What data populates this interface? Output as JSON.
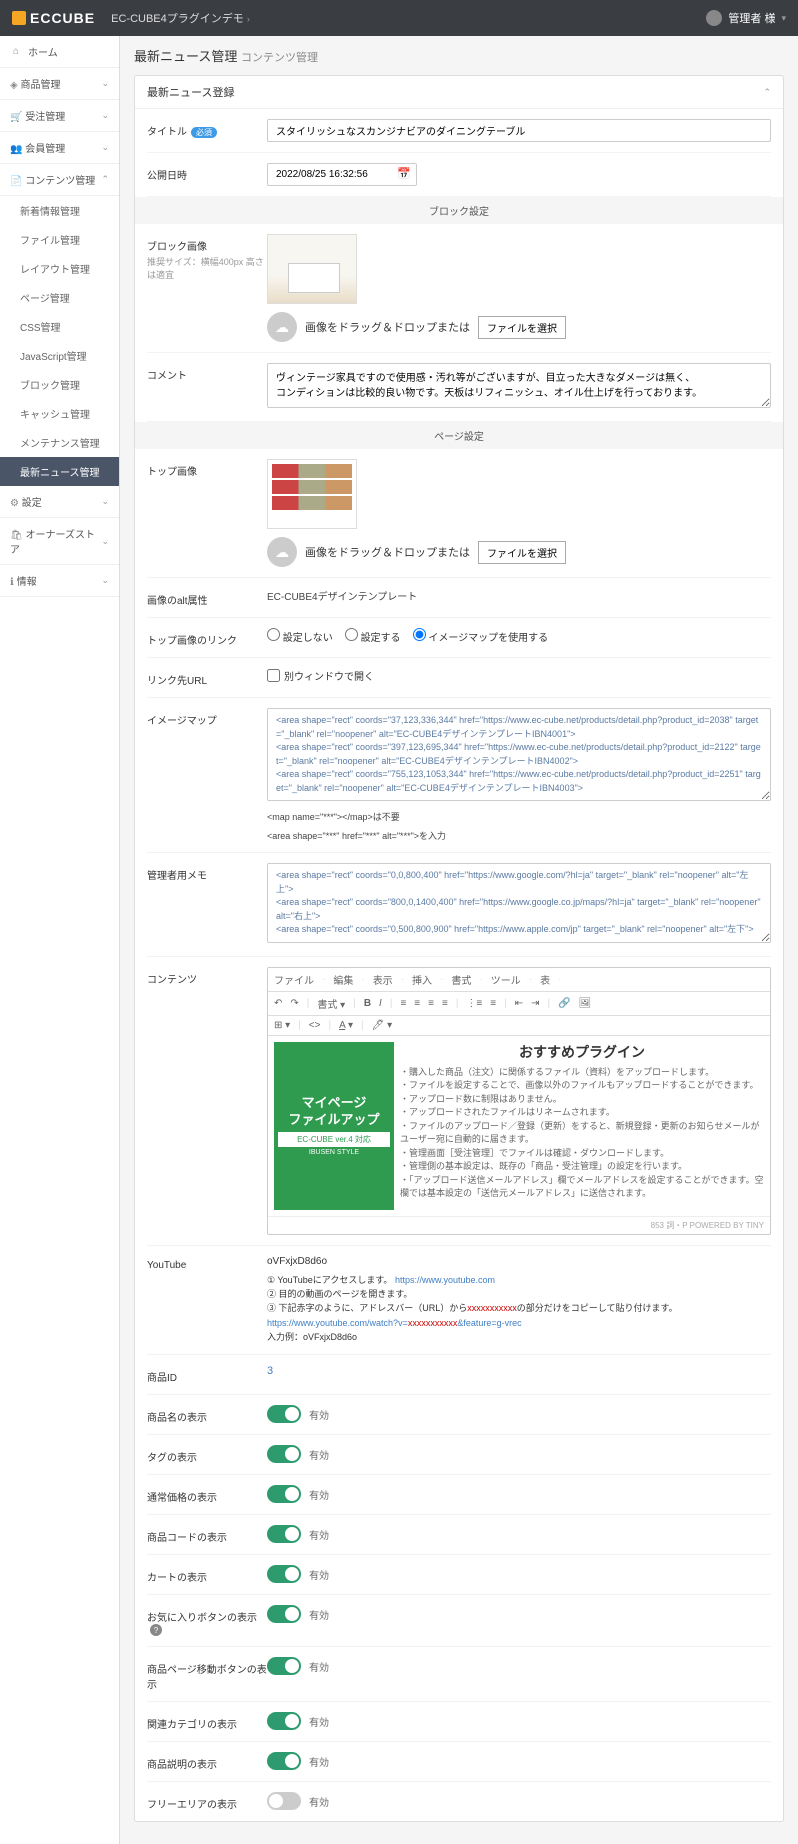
{
  "topbar": {
    "logo": "ECCUBE",
    "site": "EC-CUBE4プラグインデモ",
    "user": "管理者 様"
  },
  "sidebar": {
    "items": [
      {
        "label": "ホーム",
        "icon": "⌂"
      },
      {
        "label": "商品管理",
        "icon": "◈",
        "expandable": true
      },
      {
        "label": "受注管理",
        "icon": "🛒",
        "expandable": true
      },
      {
        "label": "会員管理",
        "icon": "👥",
        "expandable": true
      },
      {
        "label": "コンテンツ管理",
        "icon": "📄",
        "expandable": true
      }
    ],
    "content_sub": [
      "新着情報管理",
      "ファイル管理",
      "レイアウト管理",
      "ページ管理",
      "CSS管理",
      "JavaScript管理",
      "ブロック管理",
      "キャッシュ管理",
      "メンテナンス管理",
      "最新ニュース管理"
    ],
    "bottom": [
      {
        "label": "設定",
        "icon": "⚙"
      },
      {
        "label": "オーナーズストア",
        "icon": "🛍"
      },
      {
        "label": "情報",
        "icon": "ℹ"
      }
    ]
  },
  "page": {
    "title": "最新ニュース管理",
    "sub": "コンテンツ管理"
  },
  "panel_title": "最新ニュース登録",
  "labels": {
    "title": "タイトル",
    "required": "必須",
    "date": "公開日時",
    "block_section": "ブロック設定",
    "block_image": "ブロック画像",
    "block_image_note": "推奨サイズ：横幅400px 高さは適宜",
    "upload_hint": "画像をドラッグ＆ドロップまたは",
    "file_select": "ファイルを選択",
    "comment": "コメント",
    "page_section": "ページ設定",
    "top_image": "トップ画像",
    "image_alt": "画像のalt属性",
    "top_link": "トップ画像のリンク",
    "link_url": "リンク先URL",
    "imagemap": "イメージマップ",
    "admin_memo": "管理者用メモ",
    "contents": "コンテンツ",
    "youtube": "YouTube",
    "product_id": "商品ID",
    "show_product_name": "商品名の表示",
    "show_tag": "タグの表示",
    "show_price": "通常価格の表示",
    "show_product_code": "商品コードの表示",
    "show_cart": "カートの表示",
    "show_fav": "お気に入りボタンの表示",
    "show_detail_btn": "商品ページ移動ボタンの表示",
    "show_category": "関連カテゴリの表示",
    "show_desc": "商品説明の表示",
    "show_free": "フリーエリアの表示"
  },
  "values": {
    "title": "スタイリッシュなスカンジナビアのダイニングテーブル",
    "date": "2022/08/25 16:32:56",
    "comment": "ヴィンテージ家具ですので使用感・汚れ等がございますが、目立った大きなダメージは無く、\nコンディションは比較的良い物です。天板はリフィニッシュ、オイル仕上げを行っております。",
    "image_alt": "EC-CUBE4デザインテンプレート",
    "link_radio": [
      "設定しない",
      "設定する",
      "イメージマップを使用する"
    ],
    "link_radio_selected": 2,
    "new_window": "別ウィンドウで開く",
    "imagemap": "<area shape=\"rect\" coords=\"37,123,336,344\" href=\"https://www.ec-cube.net/products/detail.php?product_id=2038\" target=\"_blank\" rel=\"noopener\" alt=\"EC-CUBE4デザインテンプレートIBN4001\">\n<area shape=\"rect\" coords=\"397,123,695,344\" href=\"https://www.ec-cube.net/products/detail.php?product_id=2122\" target=\"_blank\" rel=\"noopener\" alt=\"EC-CUBE4デザインテンプレートIBN4002\">\n<area shape=\"rect\" coords=\"755,123,1053,344\" href=\"https://www.ec-cube.net/products/detail.php?product_id=2251\" target=\"_blank\" rel=\"noopener\" alt=\"EC-CUBE4デザインテンプレートIBN4003\">",
    "imagemap_note1": "<map name=\"***\"></map>は不要",
    "imagemap_note2": "<area shape=\"***\" href=\"***\" alt=\"***\">を入力",
    "admin_memo": "<area shape=\"rect\" coords=\"0,0,800,400\" href=\"https://www.google.com/?hl=ja\" target=\"_blank\" rel=\"noopener\" alt=\"左上\">\n<area shape=\"rect\" coords=\"800,0,1400,400\" href=\"https://www.google.co.jp/maps/?hl=ja\" target=\"_blank\" rel=\"noopener\" alt=\"右上\">\n<area shape=\"rect\" coords=\"0,500,800,900\" href=\"https://www.apple.com/jp\" target=\"_blank\" rel=\"noopener\" alt=\"左下\">",
    "youtube": "oVFxjxD8d6o",
    "product_id": "3",
    "toggle_on": "有効"
  },
  "editor": {
    "menus": [
      "ファイル",
      "編集",
      "表示",
      "挿入",
      "書式",
      "ツール",
      "表"
    ],
    "plugin_left": {
      "line1": "マイページ",
      "line2": "ファイルアップ",
      "ver": "EC-CUBE ver.4 対応",
      "maker": "IBUSEN STYLE"
    },
    "rec_title": "おすすめプラグイン",
    "bullets": [
      "・購入した商品（注文）に関係するファイル（資料）をアップロードします。",
      "・ファイルを設定することで、画像以外のファイルもアップロードすることができます。",
      "・アップロード数に制限はありません。",
      "・アップロードされたファイルはリネームされます。",
      "・ファイルのアップロード／登録（更新）をすると、新規登録・更新のお知らせメールがユーザー宛に自動的に届きます。",
      "・管理画面［受注管理］でファイルは確認・ダウンロードします。",
      "・管理側の基本設定は、既存の「商品・受注管理」の設定を行います。",
      "・「アップロード送信メールアドレス」欄でメールアドレスを設定することができます。空欄では基本設定の「送信元メールアドレス」に送信されます。"
    ],
    "footer": "853 詞・P POWERED BY TINY"
  },
  "yt_help": {
    "l1": "① YouTubeにアクセスします。",
    "l1_link": "https://www.youtube.com",
    "l2": "② 目的の動画のページを開きます。",
    "l3_a": "③ 下記赤字のように、アドレスバー（URL）から",
    "l3_b": "xxxxxxxxxxx",
    "l3_c": "の部分だけをコピーして貼り付けます。",
    "l4": "https://www.youtube.com/watch?v=",
    "l4_red": "xxxxxxxxxxx",
    "l4_end": "&feature=g-vrec",
    "l5": "入力例：oVFxjxD8d6o"
  }
}
